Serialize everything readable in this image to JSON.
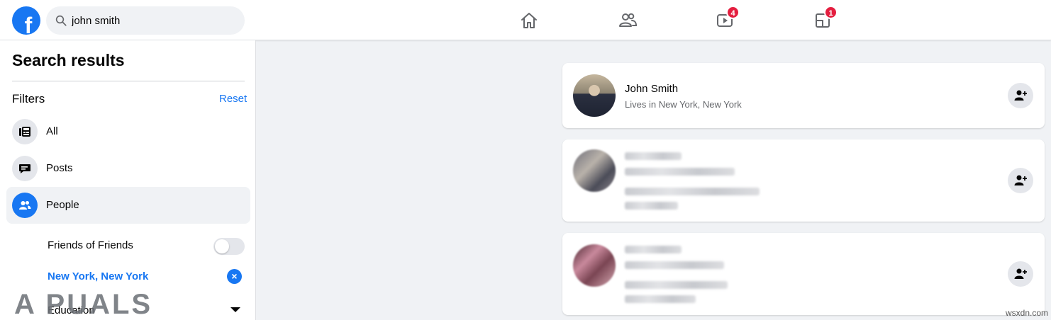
{
  "header": {
    "logo_letter": "f",
    "search_value": "john smith",
    "nav": [
      {
        "name": "home-icon",
        "badge": ""
      },
      {
        "name": "friends-icon",
        "badge": ""
      },
      {
        "name": "watch-icon",
        "badge": "4"
      },
      {
        "name": "gaming-icon",
        "badge": "1"
      }
    ],
    "badge_color": "#e41e3f",
    "accent": "#1877f2"
  },
  "sidebar": {
    "title": "Search results",
    "filters_label": "Filters",
    "reset_label": "Reset",
    "items": [
      {
        "label": "All",
        "icon": "newsfeed-icon",
        "active": false
      },
      {
        "label": "Posts",
        "icon": "posts-icon",
        "active": false
      },
      {
        "label": "People",
        "icon": "people-icon",
        "active": true
      }
    ],
    "friends_of_friends_label": "Friends of Friends",
    "friends_of_friends_on": false,
    "location_label": "New York, New York",
    "education_label": "Education"
  },
  "results": [
    {
      "name": "John Smith",
      "details": [
        "Lives in New York, New York"
      ],
      "avatar": "photo",
      "blurred": false
    },
    {
      "name": "",
      "details": [],
      "avatar": "blurred",
      "blurred": true
    },
    {
      "name": "",
      "details": [],
      "avatar": "blurred",
      "blurred": true
    }
  ],
  "watermarks": {
    "appuals": "A PUALS",
    "site": "wsxdn.com"
  }
}
